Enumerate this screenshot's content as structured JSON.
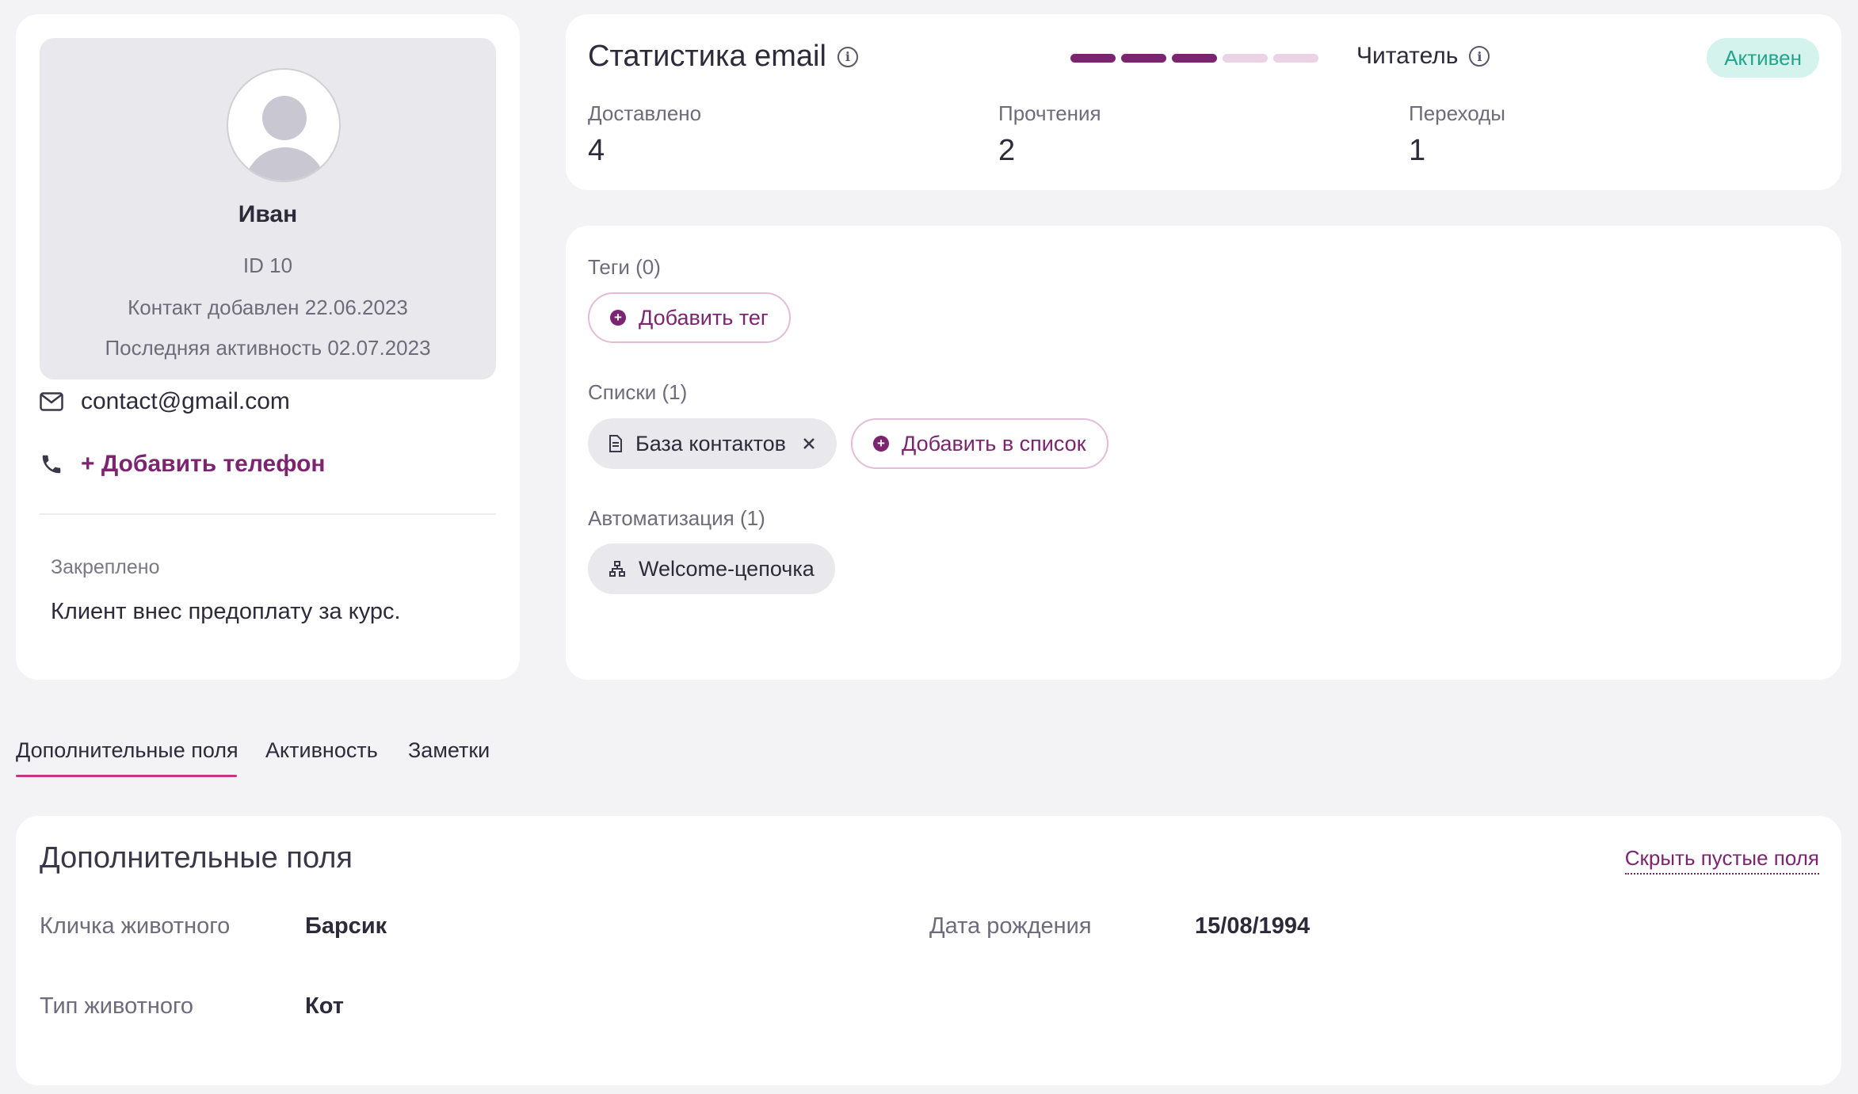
{
  "profile": {
    "name": "Иван",
    "id_text": "ID 10",
    "added_text": "Контакт добавлен 22.06.2023",
    "last_activity_text": "Последняя активность 02.07.2023",
    "email": "contact@gmail.com",
    "add_phone_label": "+ Добавить телефон",
    "pinned_label": "Закреплено",
    "pinned_text": "Клиент внес предоплату за курс."
  },
  "stats": {
    "title": "Статистика email",
    "level": 3,
    "level_max": 5,
    "role": "Читатель",
    "status": "Активен",
    "items": [
      {
        "label": "Доставлено",
        "value": "4"
      },
      {
        "label": "Прочтения",
        "value": "2"
      },
      {
        "label": "Переходы",
        "value": "1"
      }
    ]
  },
  "tags": {
    "label": "Теги (0)",
    "add_label": "Добавить тег"
  },
  "lists": {
    "label": "Списки (1)",
    "items": [
      "База контактов"
    ],
    "add_label": "Добавить в список"
  },
  "automation": {
    "label": "Автоматизация (1)",
    "items": [
      "Welcome-цепочка"
    ]
  },
  "tabs": [
    {
      "label": "Дополнительные поля",
      "active": true
    },
    {
      "label": "Активность",
      "active": false
    },
    {
      "label": "Заметки",
      "active": false
    }
  ],
  "fields": {
    "title": "Дополнительные поля",
    "hide_empty_label": "Скрыть пустые поля",
    "rows": [
      {
        "label": "Кличка животного",
        "value": "Барсик"
      },
      {
        "label": "Дата рождения",
        "value": "15/08/1994"
      },
      {
        "label": "Тип животного",
        "value": "Кот"
      }
    ]
  },
  "colors": {
    "accent": "#7d2470",
    "status_bg": "#d3f3ec",
    "status_text": "#22a58b",
    "tab_underline": "#c9327f"
  }
}
